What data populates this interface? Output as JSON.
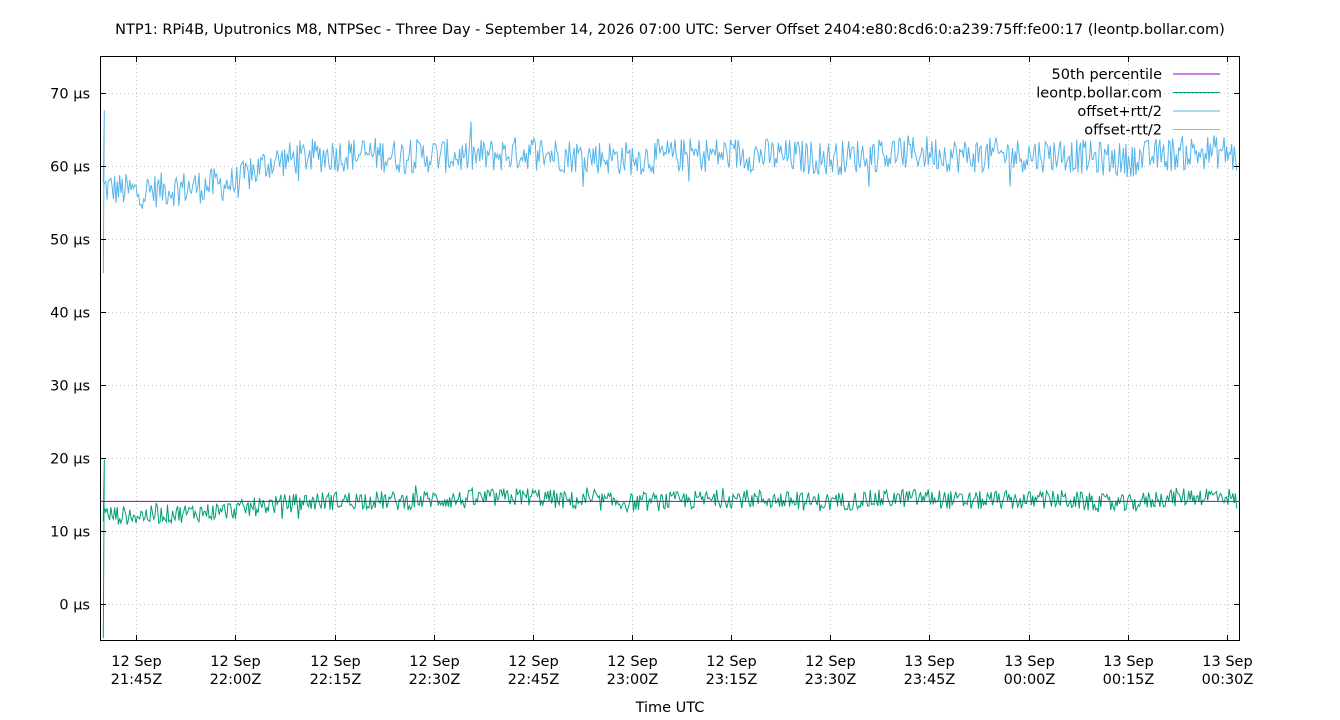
{
  "chart_data": {
    "type": "line",
    "title": "NTP1: RPi4B, Uputronics M8, NTPSec - Three Day - September 14, 2026 07:00 UTC: Server Offset 2404:e80:8cd6:0:a239:75ff:fe00:17 (leontp.bollar.com)",
    "xlabel": "Time UTC",
    "ylabel": "",
    "ylim": [
      -5,
      75
    ],
    "yunit": "µs",
    "y_ticks": [
      0,
      10,
      20,
      30,
      40,
      50,
      60,
      70
    ],
    "y_tick_labels": [
      "0 µs",
      "10 µs",
      "20 µs",
      "30 µs",
      "40 µs",
      "50 µs",
      "60 µs",
      "70 µs"
    ],
    "xlim": [
      "2026-09-12T21:39:30Z",
      "2026-09-13T00:32:00Z"
    ],
    "x_ticks": [
      {
        "t": "2026-09-12T21:45:00Z",
        "line1": "12 Sep",
        "line2": "21:45Z"
      },
      {
        "t": "2026-09-12T22:00:00Z",
        "line1": "12 Sep",
        "line2": "22:00Z"
      },
      {
        "t": "2026-09-12T22:15:00Z",
        "line1": "12 Sep",
        "line2": "22:15Z"
      },
      {
        "t": "2026-09-12T22:30:00Z",
        "line1": "12 Sep",
        "line2": "22:30Z"
      },
      {
        "t": "2026-09-12T22:45:00Z",
        "line1": "12 Sep",
        "line2": "22:45Z"
      },
      {
        "t": "2026-09-12T23:00:00Z",
        "line1": "12 Sep",
        "line2": "23:00Z"
      },
      {
        "t": "2026-09-12T23:15:00Z",
        "line1": "12 Sep",
        "line2": "23:15Z"
      },
      {
        "t": "2026-09-12T23:30:00Z",
        "line1": "12 Sep",
        "line2": "23:30Z"
      },
      {
        "t": "2026-09-12T23:45:00Z",
        "line1": "13 Sep",
        "line2": "23:45Z"
      },
      {
        "t": "2026-09-13T00:00:00Z",
        "line1": "13 Sep",
        "line2": "00:00Z"
      },
      {
        "t": "2026-09-13T00:15:00Z",
        "line1": "13 Sep",
        "line2": "00:15Z"
      },
      {
        "t": "2026-09-13T00:30:00Z",
        "line1": "13 Sep",
        "line2": "00:30Z"
      }
    ],
    "grid": true,
    "legend_position": "top-right",
    "series": [
      {
        "name": "50th percentile",
        "color": "#9400d3",
        "constant": 14.1
      },
      {
        "name": "leontp.bollar.com",
        "color": "#009e73",
        "x": [
          "2026-09-12T21:40:00Z",
          "2026-09-12T21:45:00Z",
          "2026-09-12T21:50:00Z",
          "2026-09-12T21:55:00Z",
          "2026-09-12T22:00:00Z",
          "2026-09-12T22:05:00Z",
          "2026-09-12T22:10:00Z",
          "2026-09-12T22:15:00Z",
          "2026-09-12T22:20:00Z",
          "2026-09-12T22:25:00Z",
          "2026-09-12T22:30:00Z",
          "2026-09-12T22:35:00Z",
          "2026-09-12T22:40:00Z",
          "2026-09-12T22:45:00Z",
          "2026-09-12T22:50:00Z",
          "2026-09-12T22:55:00Z",
          "2026-09-12T23:00:00Z",
          "2026-09-12T23:05:00Z",
          "2026-09-12T23:10:00Z",
          "2026-09-12T23:15:00Z",
          "2026-09-12T23:20:00Z",
          "2026-09-12T23:25:00Z",
          "2026-09-12T23:30:00Z",
          "2026-09-12T23:35:00Z",
          "2026-09-12T23:40:00Z",
          "2026-09-12T23:45:00Z",
          "2026-09-12T23:50:00Z",
          "2026-09-12T23:55:00Z",
          "2026-09-13T00:00:00Z",
          "2026-09-13T00:05:00Z",
          "2026-09-13T00:10:00Z",
          "2026-09-13T00:15:00Z",
          "2026-09-13T00:20:00Z",
          "2026-09-13T00:25:00Z",
          "2026-09-13T00:30:00Z",
          "2026-09-13T00:31:30Z"
        ],
        "values": [
          12.3,
          12.1,
          12.4,
          12.6,
          12.9,
          13.6,
          14.0,
          14.2,
          14.3,
          14.1,
          14.4,
          14.3,
          14.6,
          14.8,
          14.2,
          14.1,
          13.9,
          14.1,
          14.3,
          14.5,
          14.4,
          14.1,
          14.0,
          14.3,
          14.5,
          14.6,
          14.1,
          14.3,
          14.2,
          14.4,
          13.9,
          13.7,
          14.5,
          14.8,
          14.9,
          14.0
        ]
      },
      {
        "name": "offset+rtt/2",
        "color": "#56b4e9",
        "x": [
          "2026-09-12T21:40:00Z",
          "2026-09-12T21:45:00Z",
          "2026-09-12T21:50:00Z",
          "2026-09-12T21:55:00Z",
          "2026-09-12T22:00:00Z",
          "2026-09-12T22:05:00Z",
          "2026-09-12T22:10:00Z",
          "2026-09-12T22:15:00Z",
          "2026-09-12T22:20:00Z",
          "2026-09-12T22:25:00Z",
          "2026-09-12T22:30:00Z",
          "2026-09-12T22:35:00Z",
          "2026-09-12T22:40:00Z",
          "2026-09-12T22:45:00Z",
          "2026-09-12T22:50:00Z",
          "2026-09-12T22:55:00Z",
          "2026-09-12T23:00:00Z",
          "2026-09-12T23:05:00Z",
          "2026-09-12T23:10:00Z",
          "2026-09-12T23:15:00Z",
          "2026-09-12T23:20:00Z",
          "2026-09-12T23:25:00Z",
          "2026-09-12T23:30:00Z",
          "2026-09-12T23:35:00Z",
          "2026-09-12T23:40:00Z",
          "2026-09-12T23:45:00Z",
          "2026-09-12T23:50:00Z",
          "2026-09-12T23:55:00Z",
          "2026-09-13T00:00:00Z",
          "2026-09-13T00:05:00Z",
          "2026-09-13T00:10:00Z",
          "2026-09-13T00:15:00Z",
          "2026-09-13T00:20:00Z",
          "2026-09-13T00:25:00Z",
          "2026-09-13T00:30:00Z",
          "2026-09-13T00:31:30Z"
        ],
        "values": [
          57.0,
          56.4,
          56.8,
          57.2,
          57.6,
          60.4,
          61.2,
          61.5,
          61.6,
          61.3,
          61.4,
          61.2,
          61.5,
          61.9,
          61.4,
          61.2,
          61.0,
          61.3,
          61.5,
          61.6,
          61.4,
          61.2,
          61.0,
          61.4,
          61.7,
          61.8,
          61.3,
          61.5,
          61.4,
          61.6,
          61.0,
          60.8,
          61.5,
          61.8,
          61.9,
          60.9
        ]
      },
      {
        "name": "offset-rtt/2",
        "color": "#e6b800",
        "values": []
      }
    ]
  }
}
